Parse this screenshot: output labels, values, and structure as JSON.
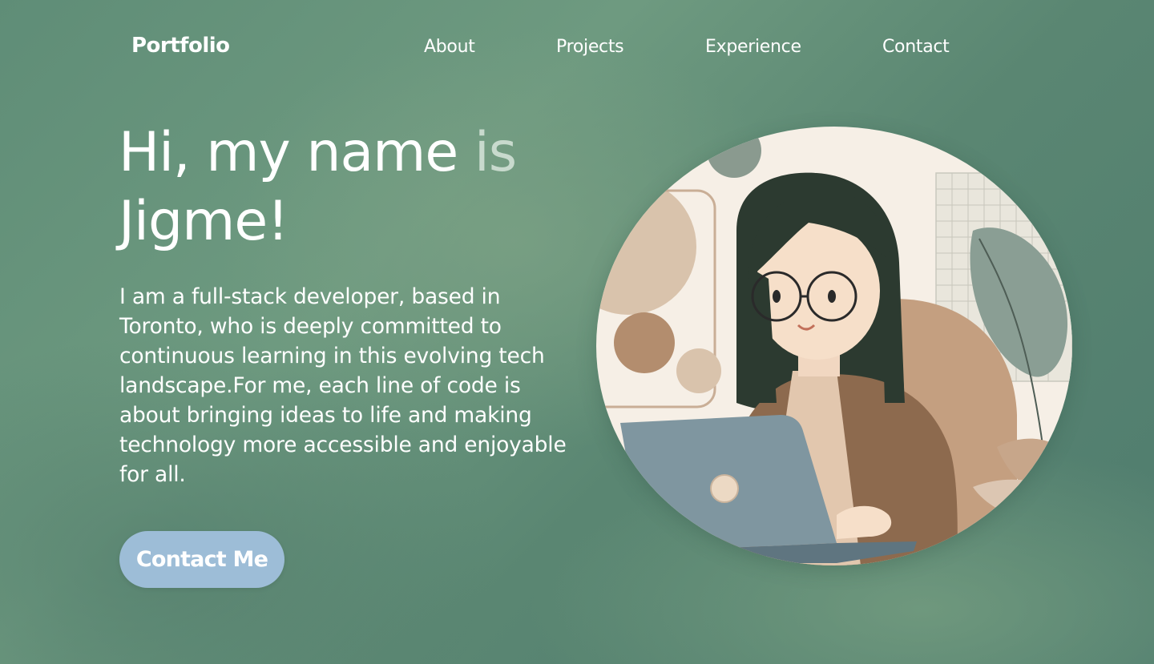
{
  "nav": {
    "brand": "Portfolio",
    "links": [
      "About",
      "Projects",
      "Experience",
      "Contact"
    ]
  },
  "hero": {
    "title_part1": "Hi, my name ",
    "title_part2": "is",
    "title_name": "Jigme!",
    "description": "I am a full-stack developer, based in Toronto, who is deeply committed to continuous learning in this evolving tech landscape.For me, each line of code is about bringing ideas to life and making technology more accessible and enjoyable for all.",
    "cta_label": "Contact Me"
  },
  "colors": {
    "background": "#5f8d77",
    "button": "#9dbdd7",
    "text": "#ffffff"
  },
  "icons": {
    "portrait": "illustrated-developer-at-laptop"
  }
}
